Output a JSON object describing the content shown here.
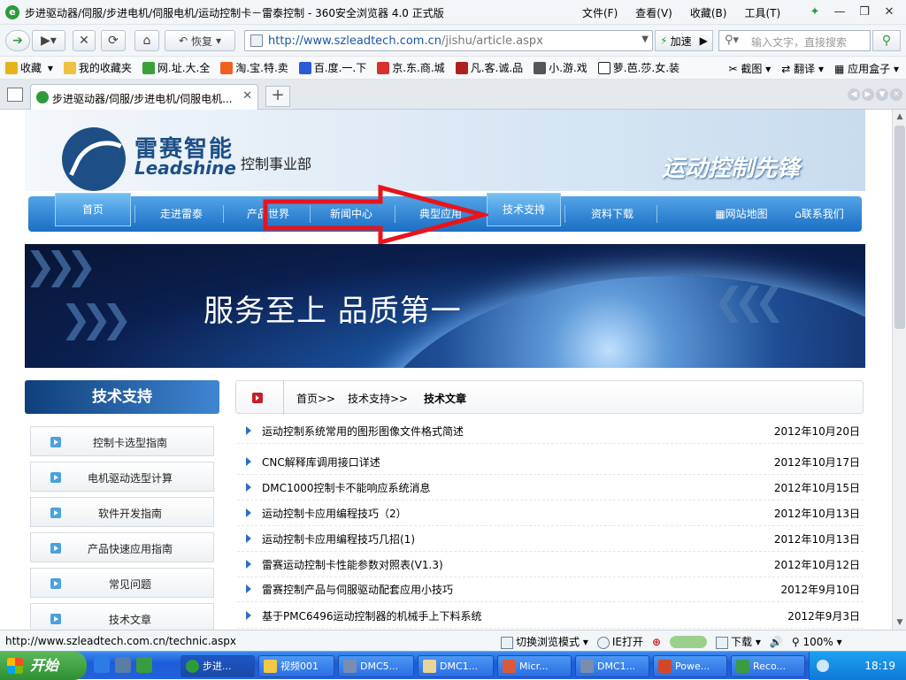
{
  "window": {
    "title": "步进驱动器/伺服/步进电机/伺服电机/运动控制卡－雷泰控制 - 360安全浏览器 4.0 正式版",
    "menu": [
      "文件(F)",
      "查看(V)",
      "收藏(B)",
      "工具(T)"
    ]
  },
  "toolbar": {
    "restore_label": "恢复",
    "url_host": "http://www.szleadtech.com.cn",
    "url_path": "/jishu/article.aspx",
    "speed_label": "加速",
    "search_placeholder": "输入文字，直接搜索"
  },
  "favorites": {
    "items": [
      {
        "label": "收藏",
        "color": "#e8b21a"
      },
      {
        "label": "我的收藏夹",
        "color": "#f0c040"
      },
      {
        "label": "网.址.大.全",
        "color": "#3aa13a"
      },
      {
        "label": "淘.宝.特.卖",
        "color": "#f06020"
      },
      {
        "label": "百.度.一.下",
        "color": "#2a5bd7"
      },
      {
        "label": "京.东.商.城",
        "color": "#d9302b"
      },
      {
        "label": "凡.客.诚.品",
        "color": "#b02020"
      },
      {
        "label": "小.游.戏",
        "color": "#555555"
      },
      {
        "label": "萝.芭.莎.女.装",
        "color": "#222222"
      }
    ],
    "right": [
      "截图",
      "翻译",
      "应用盒子"
    ]
  },
  "tabs": [
    {
      "label": "步进驱动器/伺服/步进电机/伺服电机..."
    }
  ],
  "site": {
    "brand_cn": "雷赛智能",
    "brand_en": "Leadshine",
    "division": "控制事业部",
    "slogan": "运动控制先锋",
    "nav": [
      "首页",
      "走进雷泰",
      "产品世界",
      "新闻中心",
      "典型应用",
      "技术支持",
      "资料下载",
      "网站地图",
      "联系我们"
    ],
    "banner_text": "服务至上 品质第一",
    "sidebar_title": "技术支持",
    "sidebar_items": [
      "控制卡选型指南",
      "电机驱动选型计算",
      "软件开发指南",
      "产品快速应用指南",
      "常见问题",
      "技术文章"
    ],
    "breadcrumb": [
      "首页>>",
      "技术支持>>",
      "技术文章"
    ],
    "articles": [
      {
        "title": "运动控制系统常用的图形图像文件格式简述",
        "date": "2012年10月20日"
      },
      {
        "title": "CNC解释库调用接口详述",
        "date": "2012年10月17日"
      },
      {
        "title": "DMC1000控制卡不能响应系统消息",
        "date": "2012年10月15日"
      },
      {
        "title": "运动控制卡应用编程技巧（2）",
        "date": "2012年10月13日"
      },
      {
        "title": "运动控制卡应用编程技巧几招(1)",
        "date": "2012年10月13日"
      },
      {
        "title": "雷赛运动控制卡性能参数对照表(V1.3)",
        "date": "2012年10月12日"
      },
      {
        "title": "雷赛控制产品与伺服驱动配套应用小技巧",
        "date": "2012年9月10日"
      },
      {
        "title": "基于PMC6496运动控制器的机械手上下料系统",
        "date": "2012年9月3日"
      }
    ]
  },
  "status": {
    "url": "http://www.szleadtech.com.cn/technic.aspx",
    "mode": "切换浏览模式",
    "ie": "IE打开",
    "download": "下载",
    "zoom": "100%"
  },
  "taskbar": {
    "start": "开始",
    "items": [
      "步进...",
      "视频001",
      "DMC5...",
      "DMC1...",
      "Micr...",
      "DMC1...",
      "Powe...",
      "Reco..."
    ],
    "clock": "18:19"
  },
  "colors": {
    "nav_blue": "#1b6fc4",
    "annotation_arrow": "#e8141a",
    "article_bullet": "#2b6fc2"
  }
}
